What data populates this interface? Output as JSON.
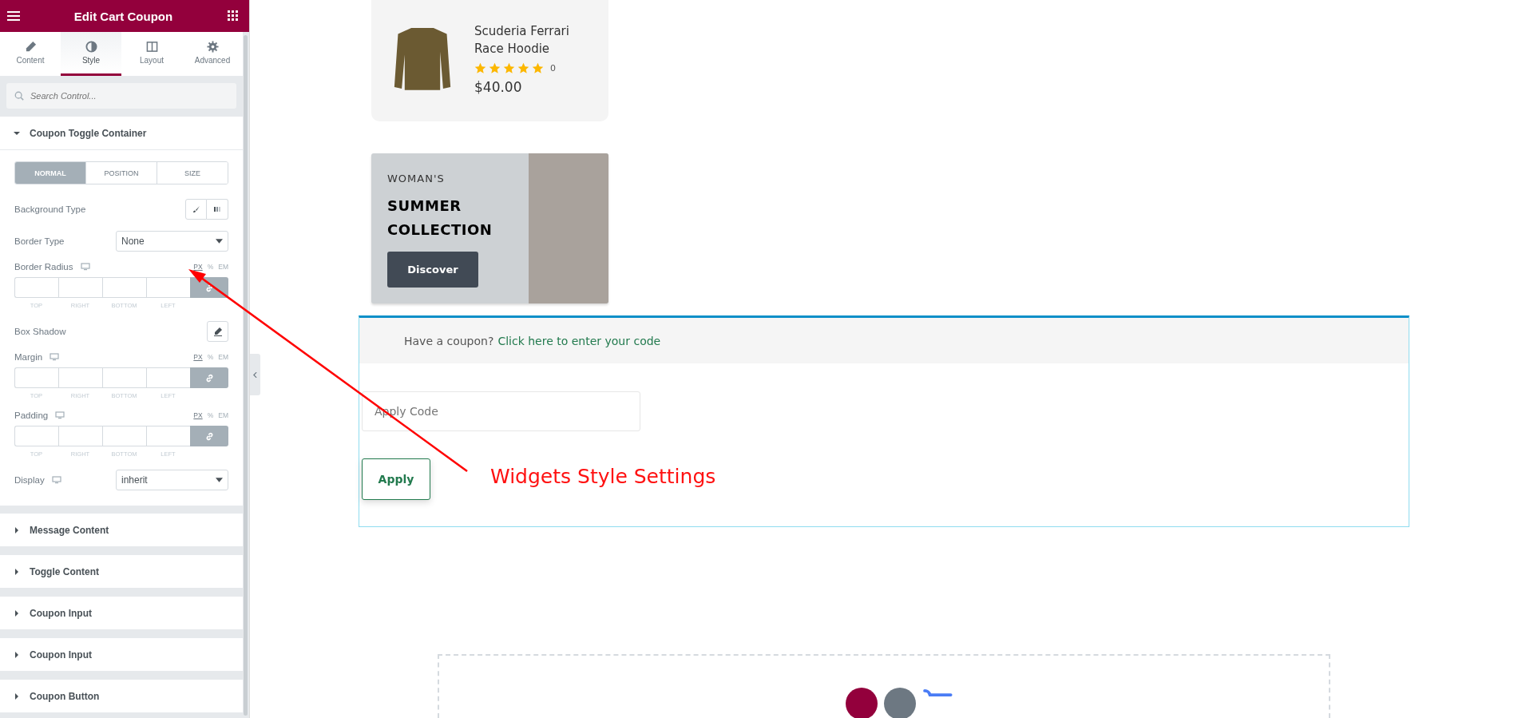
{
  "panel": {
    "title": "Edit Cart Coupon",
    "tabs": [
      {
        "label": "Content",
        "selected": false
      },
      {
        "label": "Style",
        "selected": true
      },
      {
        "label": "Layout",
        "selected": false
      },
      {
        "label": "Advanced",
        "selected": false
      }
    ],
    "search": {
      "placeholder": "Search Control..."
    },
    "sections": [
      {
        "title": "Coupon Toggle Container",
        "expanded": true,
        "controls": [
          {
            "kind": "toggle",
            "options": [
              {
                "label": "NORMAL",
                "selected": true
              },
              {
                "label": "POSITION",
                "selected": false
              },
              {
                "label": "SIZE",
                "selected": false
              }
            ]
          },
          {
            "kind": "choose",
            "label": "Background Type"
          },
          {
            "kind": "select",
            "label": "Border Type",
            "responsive": false,
            "value": "None"
          },
          {
            "kind": "dimensions",
            "label": "Border Radius",
            "responsive": true,
            "units": [
              {
                "label": "PX",
                "selected": true
              },
              {
                "label": "%",
                "selected": false
              },
              {
                "label": "EM",
                "selected": false
              }
            ],
            "fields": [
              "TOP",
              "RIGHT",
              "BOTTOM",
              "LEFT"
            ]
          },
          {
            "kind": "popover",
            "label": "Box Shadow"
          },
          {
            "kind": "dimensions",
            "label": "Margin",
            "responsive": true,
            "units": [
              {
                "label": "PX",
                "selected": true
              },
              {
                "label": "%",
                "selected": false
              },
              {
                "label": "EM",
                "selected": false
              }
            ],
            "fields": [
              "TOP",
              "RIGHT",
              "BOTTOM",
              "LEFT"
            ]
          },
          {
            "kind": "dimensions",
            "label": "Padding",
            "responsive": true,
            "units": [
              {
                "label": "PX",
                "selected": true
              },
              {
                "label": "%",
                "selected": false
              },
              {
                "label": "EM",
                "selected": false
              }
            ],
            "fields": [
              "TOP",
              "RIGHT",
              "BOTTOM",
              "LEFT"
            ]
          },
          {
            "kind": "select",
            "label": "Display",
            "responsive": true,
            "value": "inherit"
          }
        ]
      },
      {
        "title": "Message Content",
        "expanded": false
      },
      {
        "title": "Toggle Content",
        "expanded": false
      },
      {
        "title": "Coupon Input",
        "expanded": false
      },
      {
        "title": "Coupon Input",
        "expanded": false
      },
      {
        "title": "Coupon Button",
        "expanded": false
      }
    ]
  },
  "product": {
    "name": "Scuderia Ferrari Race Hoodie",
    "stars": 5,
    "review_count": "0",
    "price": "$40.00"
  },
  "banner": {
    "eyebrow": "WOMAN'S",
    "heading": "SUMMER COLLECTION",
    "button": "Discover"
  },
  "coupon": {
    "message": "Have a coupon?",
    "link": "Click here to enter your code",
    "input_placeholder": "Apply Code",
    "button": "Apply"
  },
  "annotation": {
    "text": "Widgets Style Settings"
  }
}
